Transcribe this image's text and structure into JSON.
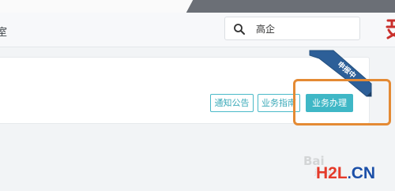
{
  "header": {
    "nav_text": "室",
    "search": {
      "value": "高企"
    }
  },
  "card": {
    "ribbon_label": "申报中",
    "buttons": {
      "notice": "通知公告",
      "guide": "业务指南",
      "handle": "业务办理"
    }
  },
  "watermark": {
    "baidu": "Bai",
    "baidu_sub": "jingyan"
  },
  "site_logo": {
    "h2l_h": "H",
    "h2l_2": "2",
    "h2l_l": "L",
    "h2l_dot": ".",
    "h2l_cn": "CN"
  },
  "colors": {
    "accent": "#3fb7c6",
    "ribbon": "#2d5f98",
    "highlight": "#e48a34",
    "brand_red": "#e53a2a",
    "brand_blue": "#1b4fa8"
  },
  "icons": {
    "search": "search-icon",
    "logo": "brand-logo-icon"
  }
}
